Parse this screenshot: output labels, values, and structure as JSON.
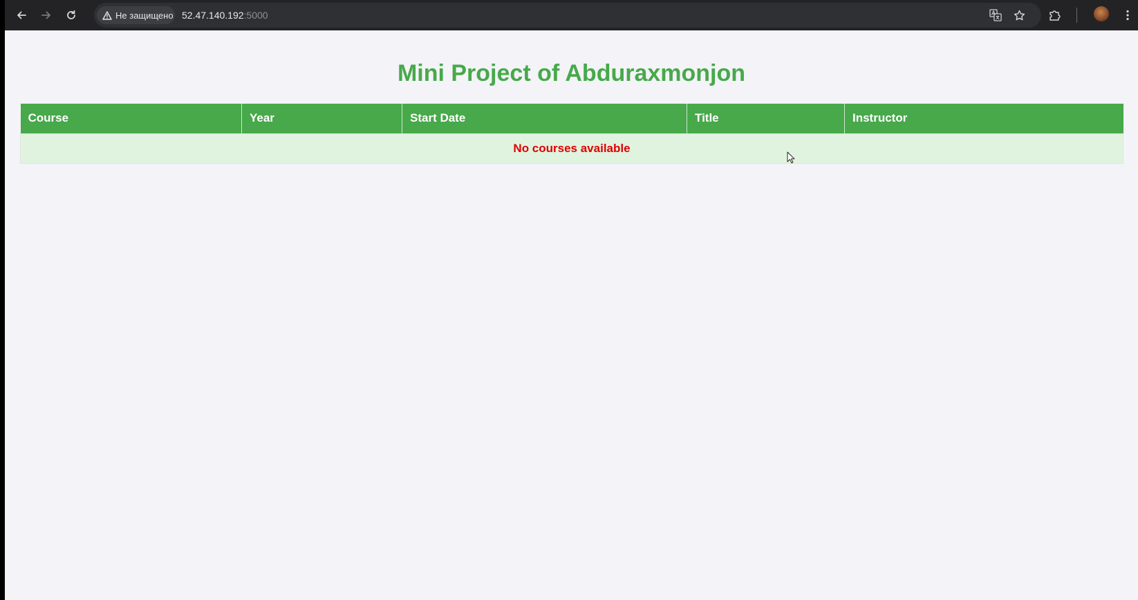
{
  "browser": {
    "security_label": "Не защищено",
    "url_host": "52.47.140.192",
    "url_port": ":5000",
    "icons": [
      "back-arrow-icon",
      "forward-arrow-icon",
      "reload-icon",
      "warning-icon",
      "translate-icon",
      "star-icon",
      "extensions-icon",
      "profile-avatar",
      "more-menu-icon"
    ]
  },
  "page": {
    "title": "Mini Project of Abduraxmonjon",
    "table": {
      "headers": [
        "Course",
        "Year",
        "Start Date",
        "Title",
        "Instructor"
      ],
      "empty_message": "No courses available"
    }
  },
  "colors": {
    "accent": "#47a94a",
    "empty_row_bg": "#e0f3de",
    "empty_text": "#e00000"
  }
}
